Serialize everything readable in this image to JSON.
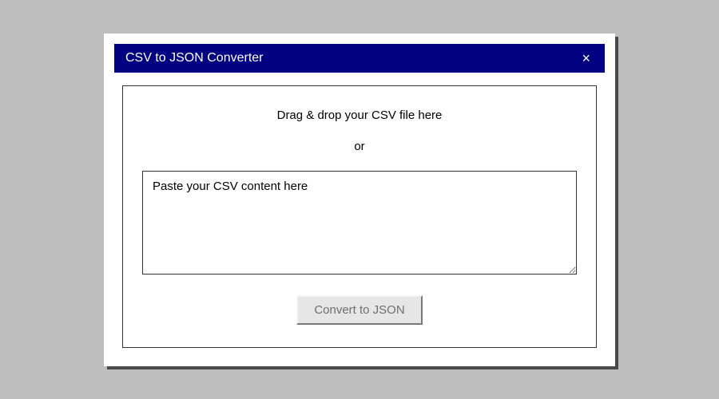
{
  "titlebar": {
    "title": "CSV to JSON Converter",
    "close_glyph": "×"
  },
  "main": {
    "drag_drop_instruction": "Drag & drop your CSV file here",
    "or_label": "or",
    "textarea_placeholder": "Paste your CSV content here",
    "textarea_value": "",
    "convert_button_label": "Convert to JSON"
  }
}
